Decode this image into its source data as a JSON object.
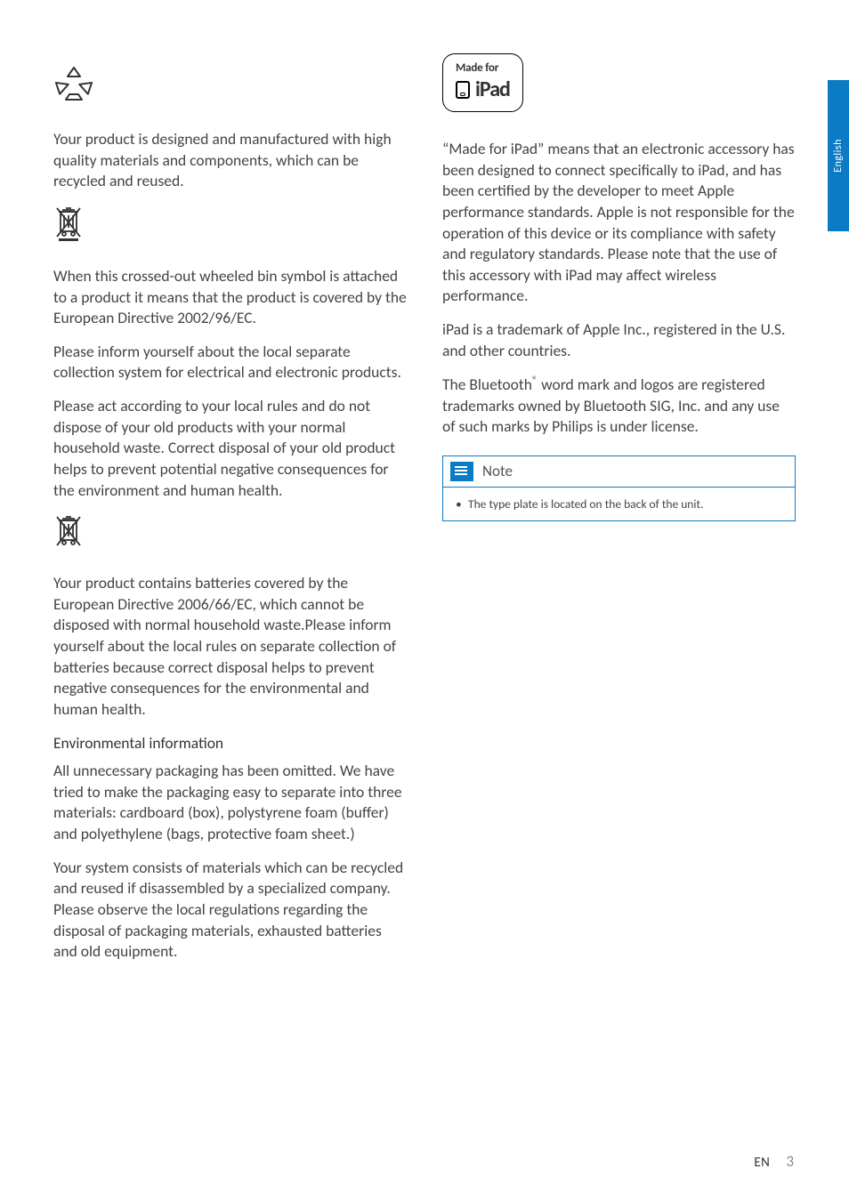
{
  "sideTab": "English",
  "left": {
    "p1": "Your product is designed and manufactured with high quality materials and components, which can be recycled and reused.",
    "p2": "When this crossed-out wheeled bin symbol is attached to a product it means that the product is covered by the European Directive 2002/96/EC.",
    "p3": "Please inform yourself about the local separate collection system for electrical and electronic products.",
    "p4": "Please act according to your local rules and do not dispose of your old products with your normal household waste. Correct disposal of your old product helps to prevent potential negative consequences for the environment and human health.",
    "p5": "Your product contains batteries covered by the European Directive 2006/66/EC, which cannot be disposed with normal household waste.Please inform yourself about the local rules on separate collection of batteries because correct disposal helps to prevent negative consequences for the environmental and human health.",
    "h1": "Environmental information",
    "p6": "All unnecessary packaging has been omitted. We have tried to make the packaging easy to separate into three materials: cardboard (box), polystyrene foam (buffer) and polyethylene (bags, protective foam sheet.)",
    "p7": "Your system consists of materials which can be recycled and reused if disassembled by a specialized company. Please observe the local regulations regarding the disposal of packaging materials, exhausted batteries and old equipment."
  },
  "right": {
    "badge_mf": "Made for",
    "badge_ipad": "iPad",
    "p1": "“Made for iPad” means that an electronic accessory has been designed to connect specifically to iPad, and has been certified by the developer to meet Apple performance standards. Apple is not responsible for the operation of this device or its compliance with safety and regulatory standards. Please note that the use of this accessory with iPad may affect wireless performance.",
    "p2": "iPad is a trademark of Apple Inc., registered in the U.S. and other countries.",
    "p3_pre": "The Bluetooth",
    "p3_post": " word mark and logos are registered trademarks owned by Bluetooth SIG, Inc. and any use of such marks by Philips is under license.",
    "note_label": "Note",
    "note_item": "The type plate is located on the back of the unit."
  },
  "footer": {
    "lang": "EN",
    "page": "3"
  }
}
